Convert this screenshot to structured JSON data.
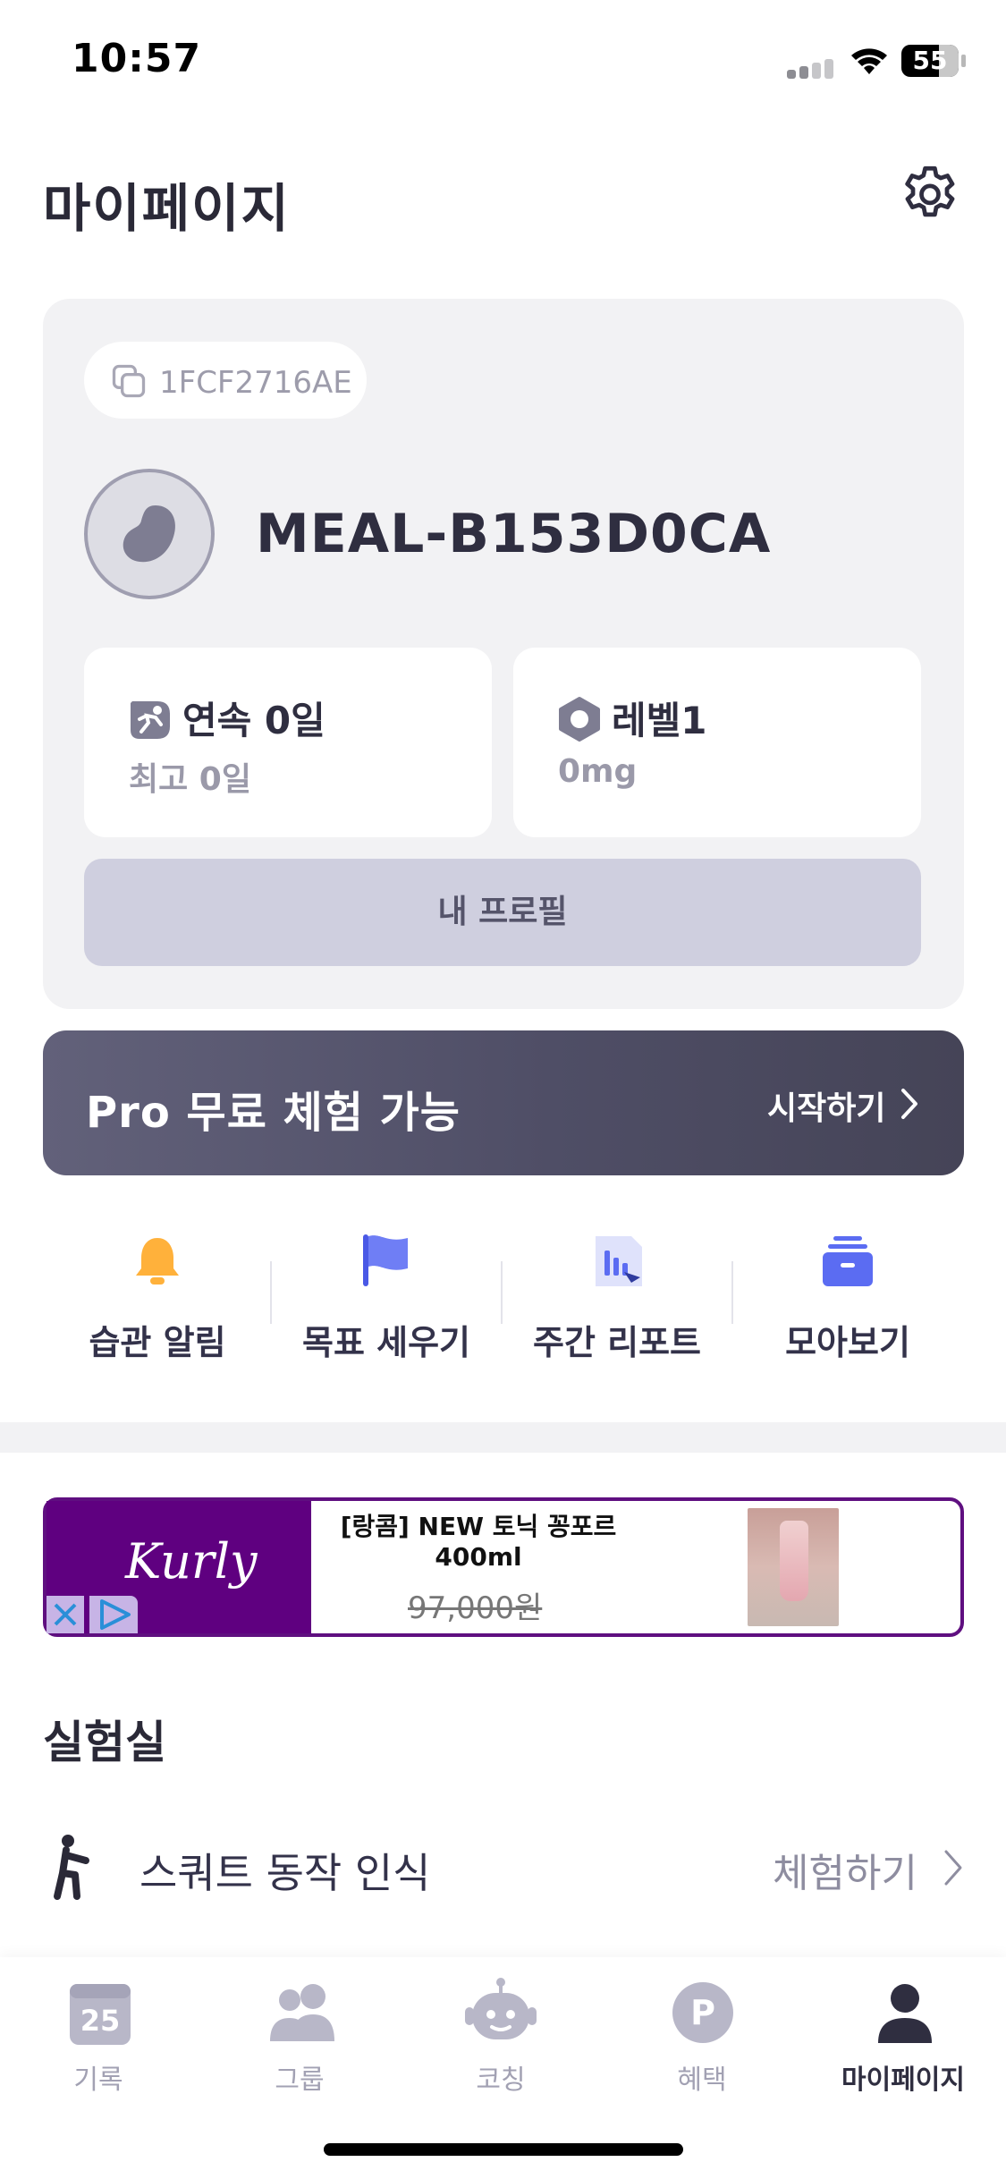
{
  "status_bar": {
    "time": "10:57",
    "battery": "55"
  },
  "header": {
    "title": "마이페이지",
    "settings_icon": "gear-icon"
  },
  "profile": {
    "user_id": "1FCF2716AE",
    "name": "MEAL-B153D0CA",
    "streak": {
      "title": "연속 0일",
      "sub": "최고 0일"
    },
    "level": {
      "title": "레벨1",
      "sub": "0mg"
    },
    "profile_button": "내 프로필"
  },
  "pro_banner": {
    "title": "Pro 무료 체험 가능",
    "cta": "시작하기"
  },
  "quick_menu": [
    {
      "label": "습관 알림",
      "icon": "bell-icon",
      "color": "#ffb13b"
    },
    {
      "label": "목표 세우기",
      "icon": "flag-icon",
      "color": "#5b6cf2"
    },
    {
      "label": "주간 리포트",
      "icon": "report-icon",
      "color": "#5b6cf2"
    },
    {
      "label": "모아보기",
      "icon": "archive-box-icon",
      "color": "#5b6cf2"
    }
  ],
  "ad": {
    "brand": "Kurly",
    "product_title": "[랑콤] NEW 토닉 꽁포르 400ml",
    "price": "97,000원"
  },
  "lab": {
    "title": "실험실",
    "item_label": "스쿼트 동작 인식",
    "item_cta": "체험하기"
  },
  "tabbar": {
    "calendar_day": "25",
    "points_letter": "P",
    "tabs": [
      {
        "label": "기록",
        "icon": "calendar-icon",
        "active": false
      },
      {
        "label": "그룹",
        "icon": "group-icon",
        "active": false
      },
      {
        "label": "코칭",
        "icon": "robot-icon",
        "active": false
      },
      {
        "label": "혜택",
        "icon": "points-icon",
        "active": false
      },
      {
        "label": "마이페이지",
        "icon": "person-icon",
        "active": true
      }
    ]
  },
  "colors": {
    "accent": "#5b6cf2",
    "banner": "#55546c",
    "ad_purple": "#5f0080"
  }
}
